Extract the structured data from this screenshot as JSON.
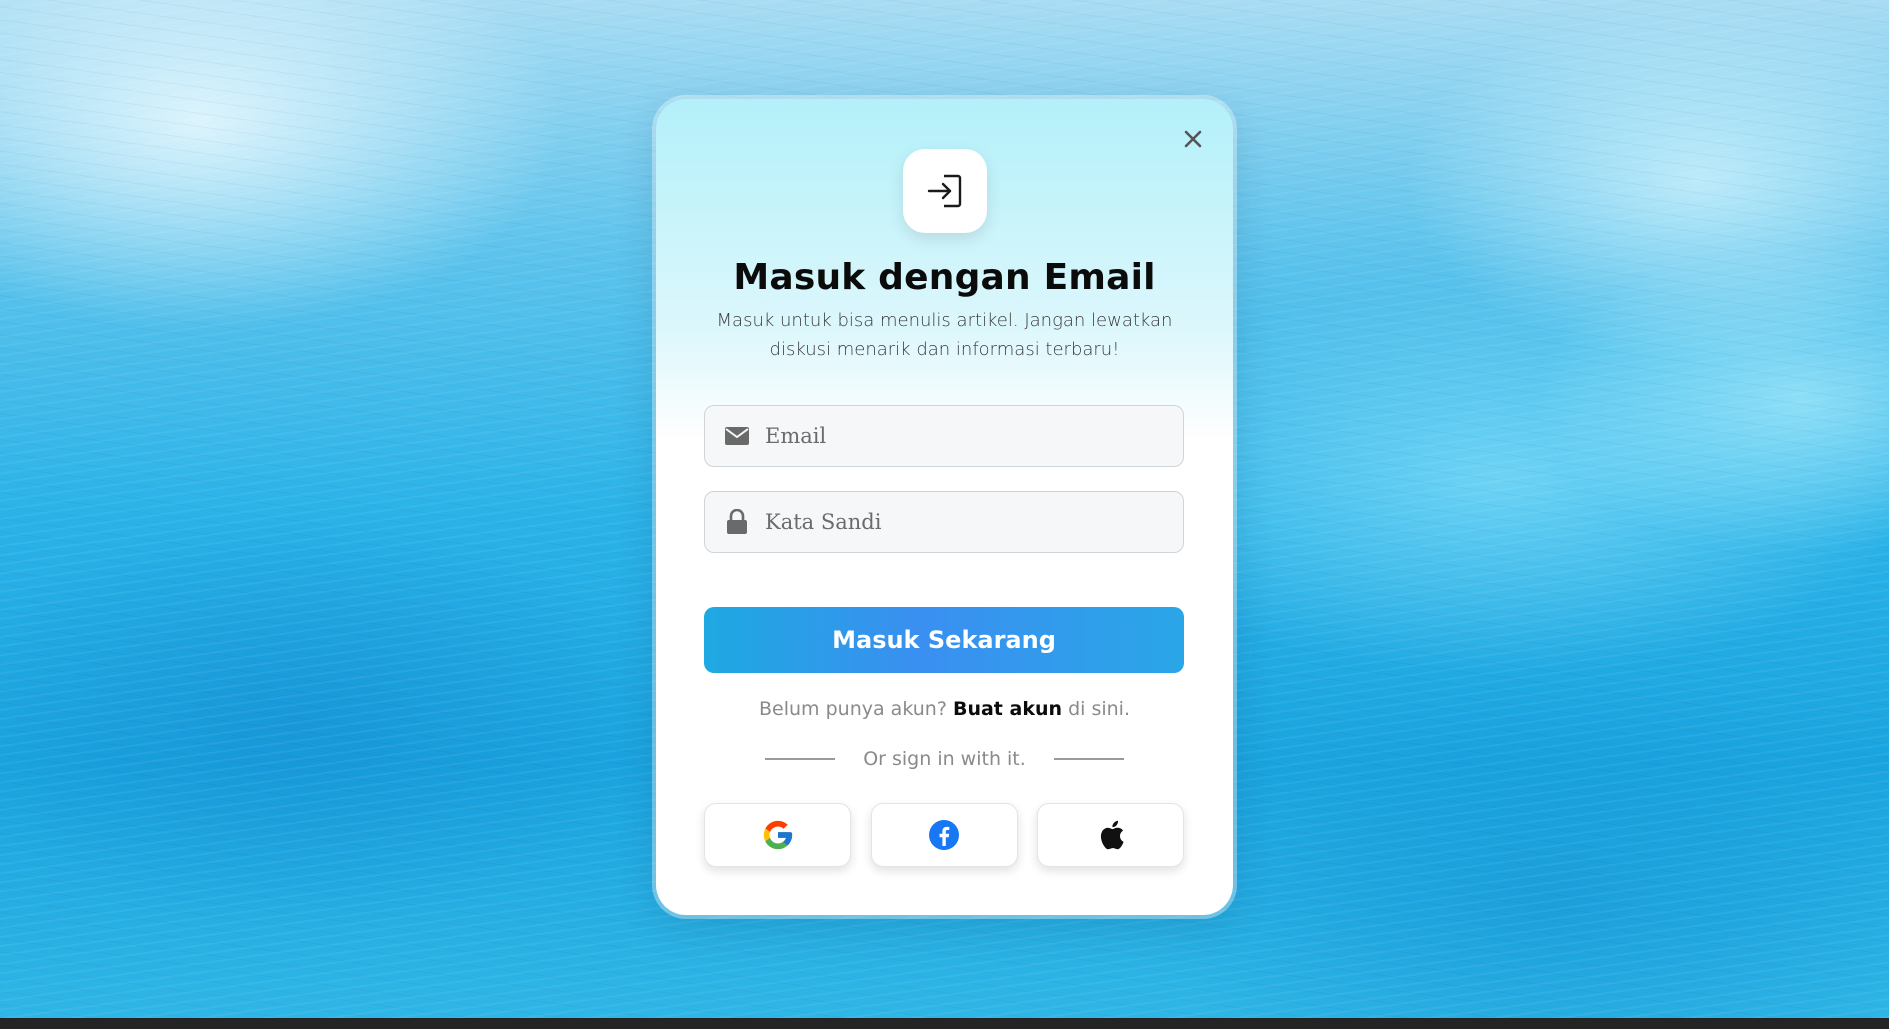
{
  "modal": {
    "title": "Masuk dengan Email",
    "subtitle": "Masuk untuk bisa menulis artikel. Jangan lewatkan diskusi menarik dan informasi terbaru!",
    "top_icon": "login-icon",
    "close_icon": "close-icon"
  },
  "form": {
    "email": {
      "placeholder": "Email",
      "value": "",
      "icon": "envelope-icon"
    },
    "password": {
      "placeholder": "Kata Sandi",
      "value": "",
      "icon": "lock-icon"
    },
    "submit_label": "Masuk Sekarang"
  },
  "signup": {
    "prefix": "Belum punya akun?",
    "link": "Buat akun",
    "suffix": "di sini."
  },
  "social": {
    "divider_text": "Or sign in with it.",
    "providers": [
      {
        "name": "Google",
        "icon": "google-icon"
      },
      {
        "name": "Facebook",
        "icon": "facebook-icon"
      },
      {
        "name": "Apple",
        "icon": "apple-icon"
      }
    ]
  },
  "colors": {
    "accent": "#3a8ff0",
    "accent_secondary": "#1ea9e1",
    "card_top": "#b3f0f9",
    "title": "#0b0b0b",
    "muted": "#8a8a8a"
  }
}
